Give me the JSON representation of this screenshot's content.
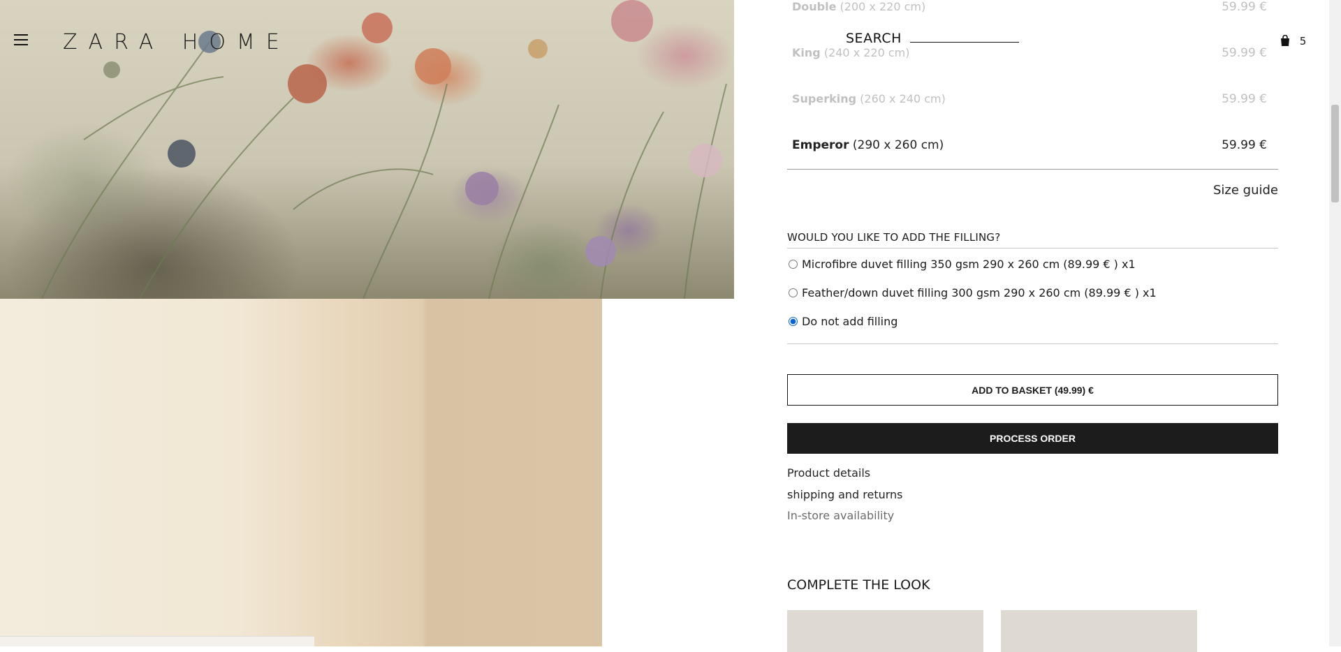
{
  "header": {
    "logo": "ZARA HOME",
    "search_label": "SEARCH",
    "basket_count": "5"
  },
  "sizes": [
    {
      "name": "Double",
      "dims": "(200 x 220 cm)",
      "price": "59.99 €",
      "state": "disabled"
    },
    {
      "name": "King",
      "dims": "(240 x 220 cm)",
      "price": "59.99 €",
      "state": "disabled"
    },
    {
      "name": "Superking",
      "dims": "(260 x 240 cm)",
      "price": "59.99 €",
      "state": "disabled"
    },
    {
      "name": "Emperor",
      "dims": "(290 x 260 cm)",
      "price": "59.99 €",
      "state": "active"
    }
  ],
  "size_guide": "Size guide",
  "filling": {
    "title": "WOULD YOU LIKE TO ADD THE FILLING?",
    "options": [
      {
        "label": "Microfibre duvet filling 350 gsm 290 x 260 cm (89.99 € ) x1",
        "checked": false
      },
      {
        "label": "Feather/down duvet filling 300 gsm 290 x 260 cm (89.99 € ) x1",
        "checked": false
      },
      {
        "label": "Do not add filling",
        "checked": true
      }
    ]
  },
  "buttons": {
    "add_to_basket": "ADD TO BASKET (49.99) €",
    "process_order": "PROCESS ORDER"
  },
  "links": {
    "product_details": "Product details",
    "shipping": "shipping and returns",
    "availability": "In-store availability"
  },
  "complete_the_look": "COMPLETE THE LOOK",
  "colors": {
    "primary_button": "#1c1c1c",
    "radio_selected": "#0a63d6"
  }
}
